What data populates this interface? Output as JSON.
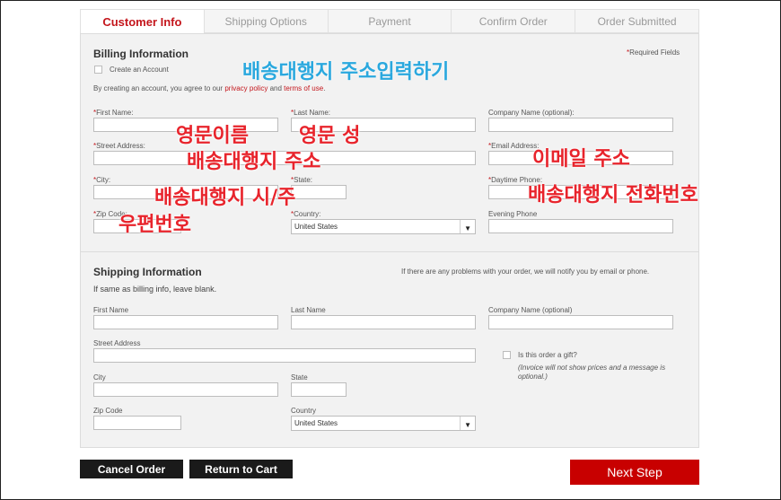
{
  "tabs": [
    "Customer Info",
    "Shipping Options",
    "Payment",
    "Confirm Order",
    "Order Submitted"
  ],
  "billing": {
    "title": "Billing Information",
    "required_note": "Required Fields",
    "create_account": "Create an Account",
    "agree_prefix": "By creating an account, you agree to our",
    "privacy": "privacy policy",
    "and": "and",
    "terms": "terms of use",
    "first_name": "First Name:",
    "last_name": "Last Name:",
    "company": "Company Name (optional):",
    "street": "Street Address:",
    "email": "Email Address:",
    "city": "City:",
    "state": "State:",
    "daytime_phone": "Daytime Phone:",
    "zip": "Zip Code:",
    "country": "Country:",
    "country_value": "United States",
    "evening_phone": "Evening Phone"
  },
  "shipping": {
    "title": "Shipping Information",
    "notify": "If there are any problems with your order, we will notify you by email or phone.",
    "same_note": "If same as billing info, leave blank.",
    "first_name": "First Name",
    "last_name": "Last Name",
    "company": "Company Name (optional)",
    "street": "Street Address",
    "gift": "Is this order a gift?",
    "gift_note": "(Invoice will not show prices and a message is optional.)",
    "city": "City",
    "state": "State",
    "zip": "Zip Code",
    "country": "Country",
    "country_value": "United States"
  },
  "buttons": {
    "cancel": "Cancel Order",
    "return": "Return to Cart",
    "next": "Next Step"
  },
  "annotations": {
    "ship_address_input": "배송대행지 주소입력하기",
    "eng_first": "영문이름",
    "eng_last": "영문 성",
    "ship_address": "배송대행지 주소",
    "email": "이메일 주소",
    "ship_city_state": "배송대행지 시/주",
    "ship_phone": "배송대행지 전화번호",
    "zip": "우편번호"
  },
  "colors": {
    "accent": "#c4161c",
    "next_button": "#c80000",
    "annotation_red": "#e8242c",
    "annotation_blue": "#2aa8de"
  }
}
